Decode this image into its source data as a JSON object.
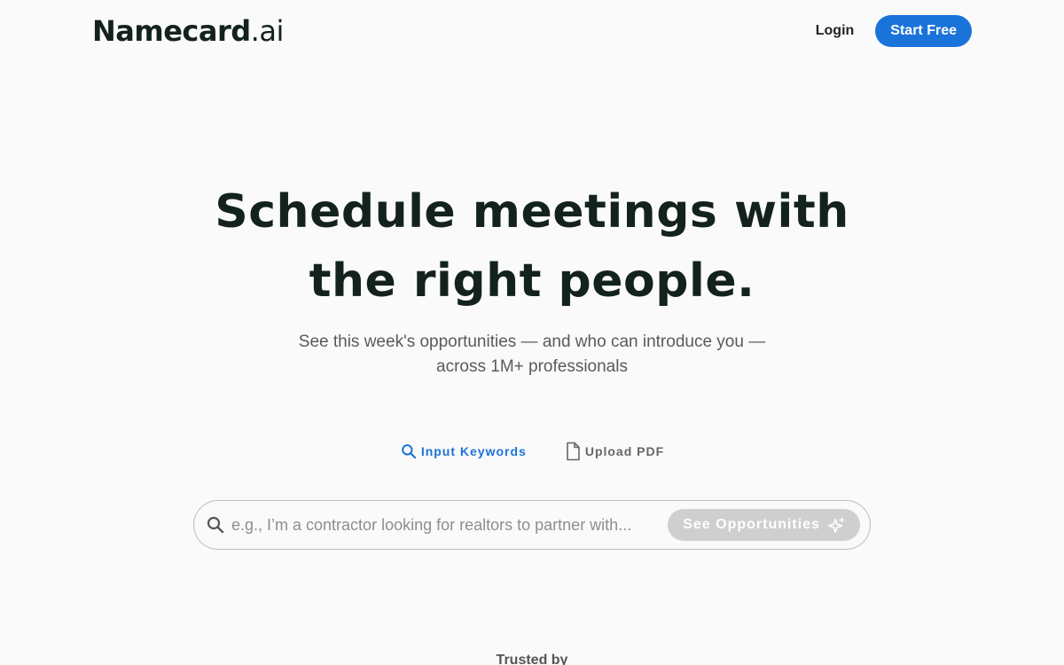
{
  "header": {
    "logo_name": "Namecard",
    "logo_tld": ".ai",
    "login_label": "Login",
    "start_free_label": "Start Free",
    "accent_color": "#1a73d9"
  },
  "hero": {
    "title_line1": "Schedule meetings with",
    "title_line2": "the right people.",
    "subtitle_line1": "See this week's opportunities — and who can introduce you —",
    "subtitle_line2": "across 1M+ professionals"
  },
  "modes": {
    "keywords_label": "Input Keywords",
    "keywords_icon": "search-icon",
    "upload_label": "Upload PDF",
    "upload_icon": "document-icon",
    "active": "keywords"
  },
  "search": {
    "value": "",
    "placeholder": "e.g., I’m a contractor looking for realtors to partner with...",
    "button_label": "See Opportunities",
    "button_icon": "sparkle-icon"
  },
  "footer": {
    "trusted_label": "Trusted by"
  }
}
